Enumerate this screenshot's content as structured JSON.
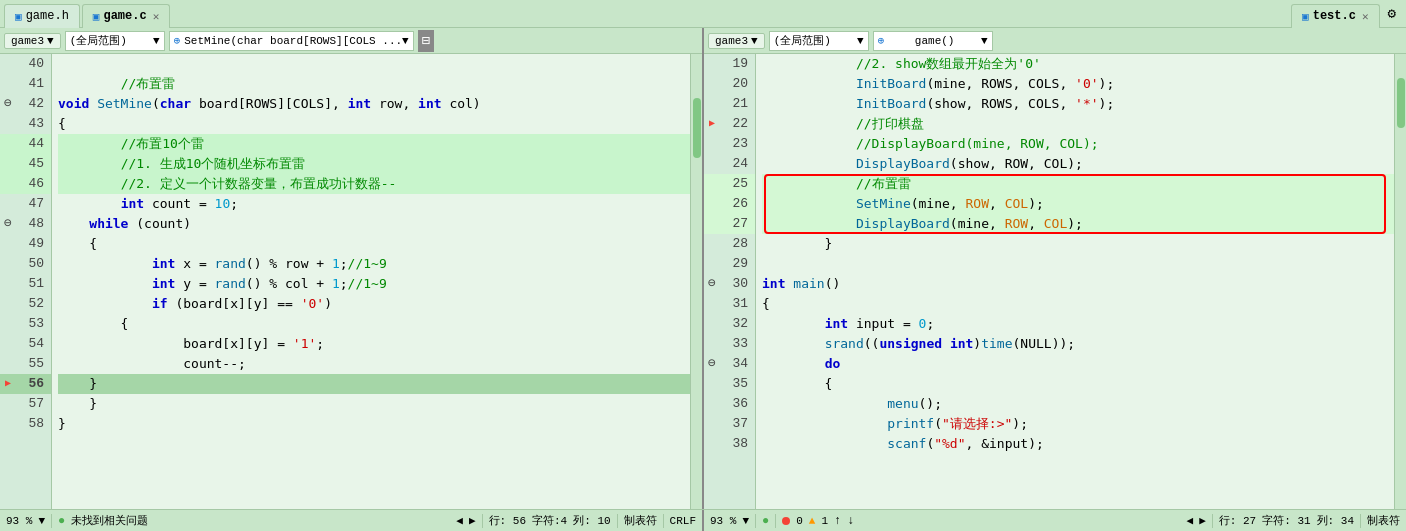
{
  "tabs": {
    "left": [
      {
        "label": "game.h",
        "active": false,
        "closable": false
      },
      {
        "label": "game.c",
        "active": true,
        "closable": true
      }
    ],
    "right": [
      {
        "label": "test.c",
        "active": true,
        "closable": true
      }
    ]
  },
  "left_pane": {
    "toolbar": {
      "scope_btn": "game3",
      "scope_dropdown": "(全局范围)",
      "func_dropdown": "SetMine(char board[ROWS][COLS ..."
    },
    "lines": [
      {
        "num": 40,
        "marker": "",
        "indent": 0,
        "code": ""
      },
      {
        "num": 41,
        "marker": "",
        "indent": 1,
        "code": "//布置雷"
      },
      {
        "num": 42,
        "marker": "=",
        "indent": 0,
        "code": "void SetMine(char board[ROWS][COLS], int row, int col)"
      },
      {
        "num": 43,
        "marker": "",
        "indent": 0,
        "code": "{"
      },
      {
        "num": 44,
        "marker": "",
        "indent": 2,
        "code": "//布置10个雷"
      },
      {
        "num": 45,
        "marker": "",
        "indent": 2,
        "code": "//1. 生成10个随机坐标布置雷"
      },
      {
        "num": 46,
        "marker": "",
        "indent": 2,
        "code": "//2. 定义一个计数器变量，布置成功计数器--"
      },
      {
        "num": 47,
        "marker": "",
        "indent": 2,
        "code": "int count = 10;"
      },
      {
        "num": 48,
        "marker": "-",
        "indent": 1,
        "code": "while (count)"
      },
      {
        "num": 49,
        "marker": "",
        "indent": 1,
        "code": "{"
      },
      {
        "num": 50,
        "marker": "",
        "indent": 3,
        "code": "int x = rand() % row + 1;//1~9"
      },
      {
        "num": 51,
        "marker": "",
        "indent": 3,
        "code": "int y = rand() % col + 1;//1~9"
      },
      {
        "num": 52,
        "marker": "",
        "indent": 3,
        "code": "if (board[x][y] == '0')"
      },
      {
        "num": 53,
        "marker": "",
        "indent": 2,
        "code": "{"
      },
      {
        "num": 54,
        "marker": "",
        "indent": 4,
        "code": "board[x][y] = '1';"
      },
      {
        "num": 55,
        "marker": "",
        "indent": 4,
        "code": "count--;"
      },
      {
        "num": 56,
        "marker": "arrow",
        "indent": 1,
        "code": "}"
      },
      {
        "num": 57,
        "marker": "",
        "indent": 1,
        "code": "}"
      },
      {
        "num": 58,
        "marker": "",
        "indent": 0,
        "code": "}"
      }
    ],
    "status": {
      "zoom": "93 %",
      "indicator": "●",
      "message": "未找到相关问题",
      "row": "行: 56",
      "col_label": "字符:4",
      "col_num": "列: 10",
      "line_ending": "制表符",
      "encoding": "CRLF"
    }
  },
  "right_pane": {
    "toolbar": {
      "scope_btn": "game3",
      "scope_dropdown": "(全局范围)",
      "func_dropdown": "game()"
    },
    "lines": [
      {
        "num": 19,
        "marker": "",
        "code": "//2. show数组最开始全为'0'"
      },
      {
        "num": 20,
        "marker": "",
        "code": "InitBoard(mine, ROWS, COLS, '0');"
      },
      {
        "num": 21,
        "marker": "",
        "code": "InitBoard(show, ROWS, COLS, '*');"
      },
      {
        "num": 22,
        "marker": "bookmark",
        "code": "//打印棋盘"
      },
      {
        "num": 23,
        "marker": "",
        "code": "//DisplayBoard(mine, ROW, COL);"
      },
      {
        "num": 24,
        "marker": "",
        "code": "DisplayBoard(show, ROW, COL);"
      },
      {
        "num": 25,
        "marker": "red-box-start",
        "code": "//布置雷"
      },
      {
        "num": 26,
        "marker": "red-box",
        "code": "SetMine(mine, ROW, COL);"
      },
      {
        "num": 27,
        "marker": "red-box-end",
        "code": "DisplayBoard(mine, ROW, COL);"
      },
      {
        "num": 28,
        "marker": "",
        "code": "}"
      },
      {
        "num": 29,
        "marker": "",
        "code": ""
      },
      {
        "num": 30,
        "marker": "=",
        "code": "int main()"
      },
      {
        "num": 31,
        "marker": "",
        "code": "{"
      },
      {
        "num": 32,
        "marker": "",
        "code": "int input = 0;"
      },
      {
        "num": 33,
        "marker": "",
        "code": "srand((unsigned int)time(NULL));"
      },
      {
        "num": 34,
        "marker": "-",
        "code": "do"
      },
      {
        "num": 35,
        "marker": "",
        "code": "{"
      },
      {
        "num": 36,
        "marker": "",
        "code": "menu();"
      },
      {
        "num": 37,
        "marker": "",
        "code": "printf(\"请选择:>\");"
      },
      {
        "num": 38,
        "marker": "",
        "code": "scanf(\"%d\", &input);"
      }
    ],
    "status": {
      "zoom": "93 %",
      "indicator": "●",
      "errors": "0",
      "warnings": "1",
      "up_arrow": "↑",
      "down_arrow": "↓",
      "row": "行: 27",
      "col_label": "字符: 31",
      "col_num": "列: 34",
      "line_ending": "制表符"
    }
  }
}
